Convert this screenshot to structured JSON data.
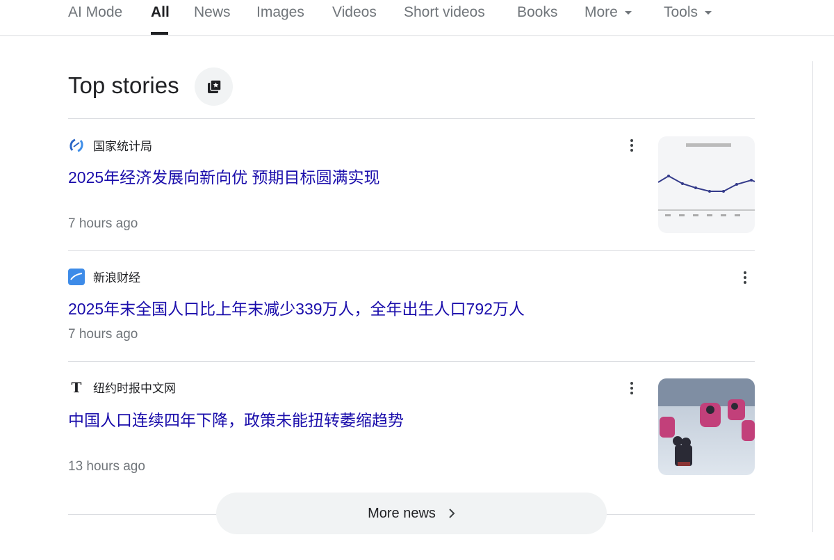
{
  "tabs": [
    {
      "label": "AI Mode"
    },
    {
      "label": "All",
      "active": true
    },
    {
      "label": "News"
    },
    {
      "label": "Images"
    },
    {
      "label": "Videos"
    },
    {
      "label": "Short videos"
    },
    {
      "label": "Books"
    },
    {
      "label": "More"
    },
    {
      "label": "Tools"
    }
  ],
  "section": {
    "title": "Top stories",
    "icon": "top-stories-icon"
  },
  "stories": [
    {
      "source": "国家统计局",
      "title": "2025年经济发展向新向优 预期目标圆满实现",
      "time": "7 hours ago",
      "thumbnail": "unemployment-rate-chart"
    },
    {
      "source": "新浪财经",
      "title": "2025年末全国人口比上年末减少339万人，全年出生人口792万人",
      "time": "7 hours ago"
    },
    {
      "source": "纽约时报中文网",
      "title": "中国人口连续四年下降，政策未能扭转萎缩趋势",
      "time": "13 hours ago",
      "thumbnail": "snow-sled-photo"
    }
  ],
  "more_news": {
    "label": "More news"
  },
  "colors": {
    "link": "#1a0dab",
    "meta": "#70757a"
  }
}
